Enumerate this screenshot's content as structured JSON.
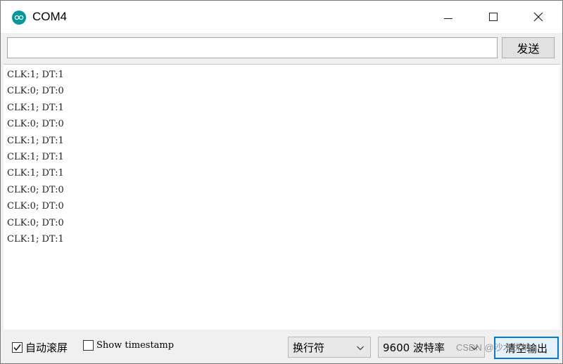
{
  "window": {
    "title": "COM4",
    "controls": [
      "minimize",
      "maximize",
      "close"
    ]
  },
  "send_row": {
    "input_value": "",
    "send_label": "发送"
  },
  "output": {
    "lines": [
      "CLK:1; DT:1",
      "CLK:0; DT:0",
      "CLK:1; DT:1",
      "CLK:0; DT:0",
      "CLK:1; DT:1",
      "CLK:1; DT:1",
      "CLK:1; DT:1",
      "CLK:0; DT:0",
      "CLK:0; DT:0",
      "CLK:0; DT:0",
      "CLK:1; DT:1"
    ]
  },
  "bottom": {
    "autoscroll_label": "自动滚屏",
    "autoscroll_checked": true,
    "timestamp_label": "Show timestamp",
    "timestamp_checked": false,
    "line_ending": "换行符",
    "baud_rate": "9600 波特率",
    "clear_label": "清空输出"
  },
  "watermark": "CSDN @沙木优纳",
  "colors": {
    "accent": "#0078d7",
    "app_icon": "#00979c"
  }
}
